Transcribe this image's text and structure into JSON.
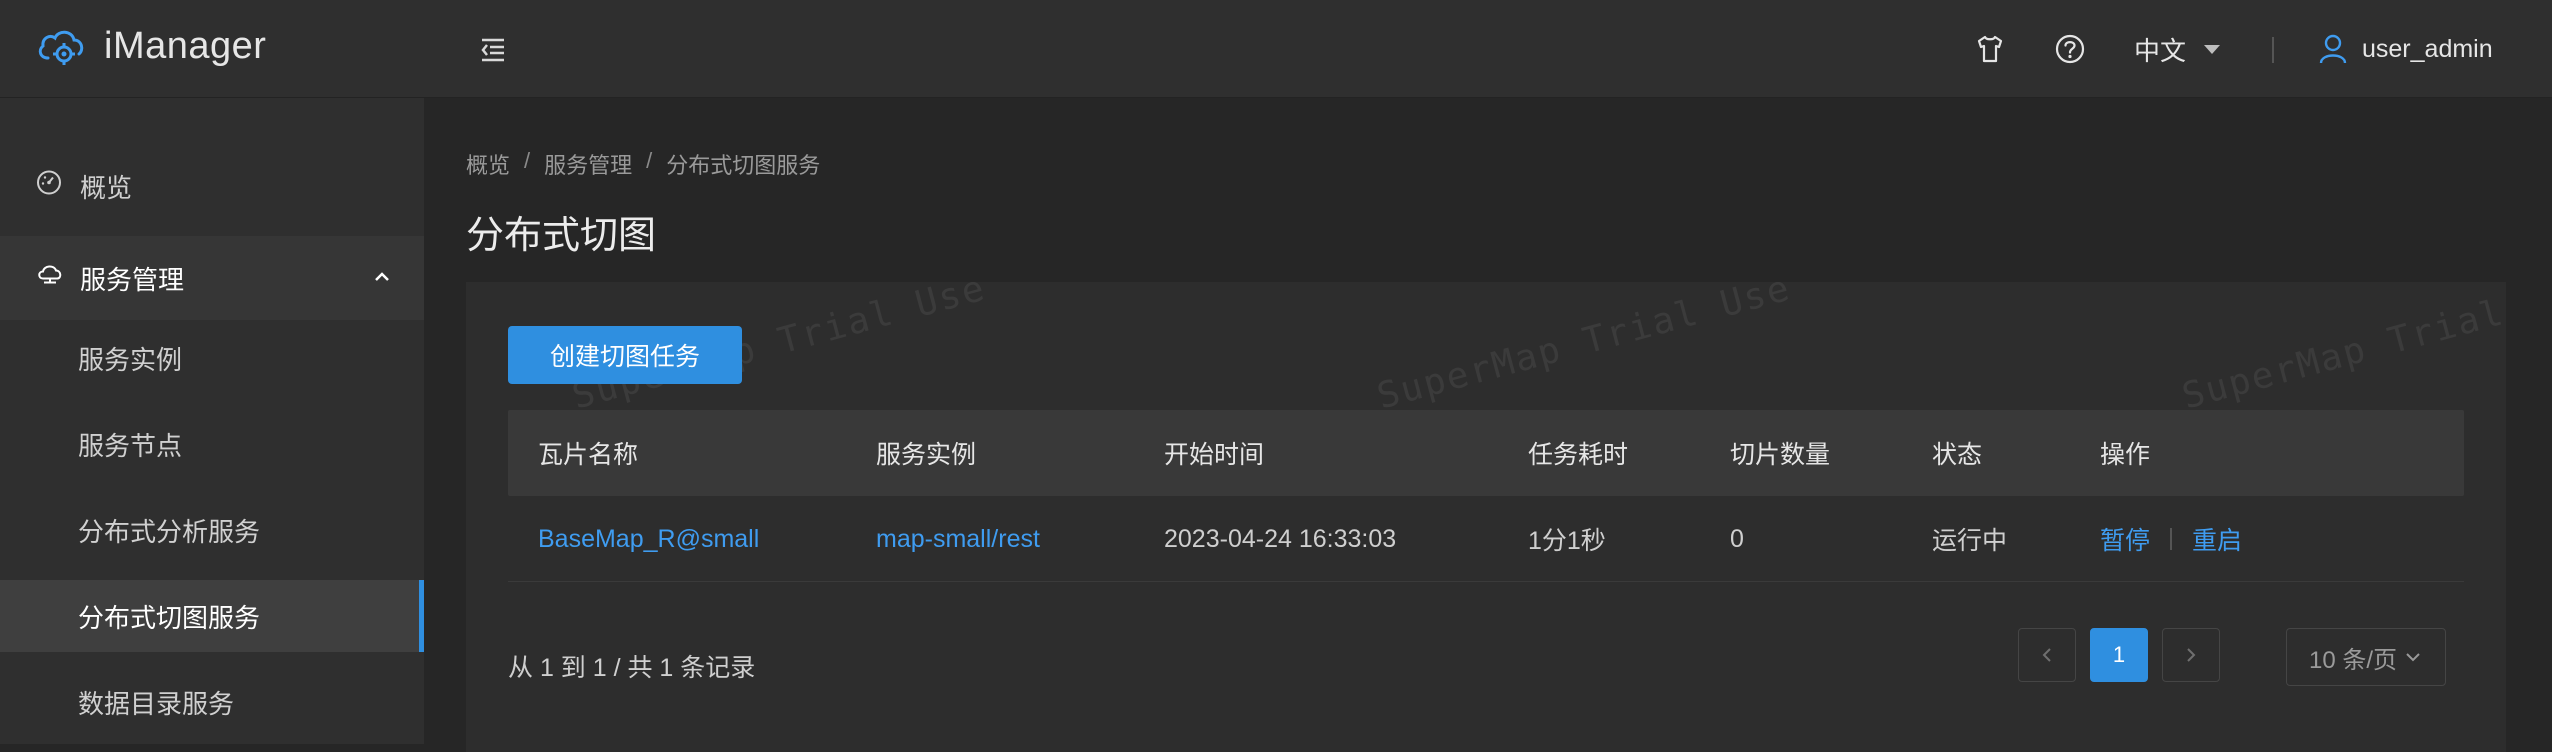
{
  "app": {
    "title": "iManager"
  },
  "header": {
    "language": "中文",
    "username": "user_admin"
  },
  "sidebar": {
    "items": [
      {
        "label": "概览"
      },
      {
        "label": "服务管理"
      },
      {
        "label": "服务实例"
      },
      {
        "label": "服务节点"
      },
      {
        "label": "分布式分析服务"
      },
      {
        "label": "分布式切图服务"
      },
      {
        "label": "数据目录服务"
      }
    ]
  },
  "breadcrumb": [
    "概览",
    "服务管理",
    "分布式切图服务"
  ],
  "page": {
    "title": "分布式切图"
  },
  "panel": {
    "create_label": "创建切图任务",
    "watermark": "SuperMap Trial Use"
  },
  "table": {
    "columns": [
      "瓦片名称",
      "服务实例",
      "开始时间",
      "任务耗时",
      "切片数量",
      "状态",
      "操作"
    ],
    "rows": [
      {
        "tile_name": "BaseMap_R@small",
        "service_instance": "map-small/rest",
        "start_time": "2023-04-24 16:33:03",
        "duration": "1分1秒",
        "tile_count": "0",
        "status": "运行中",
        "actions": [
          "暂停",
          "重启"
        ]
      }
    ]
  },
  "pagination": {
    "summary": "从 1 到 1 / 共 1 条记录",
    "current_page": "1",
    "page_size": "10 条/页"
  },
  "colors": {
    "accent": "#2f8fe0",
    "link": "#3f9cf0",
    "background": "#262626",
    "sidebar": "#2f2f2f"
  }
}
